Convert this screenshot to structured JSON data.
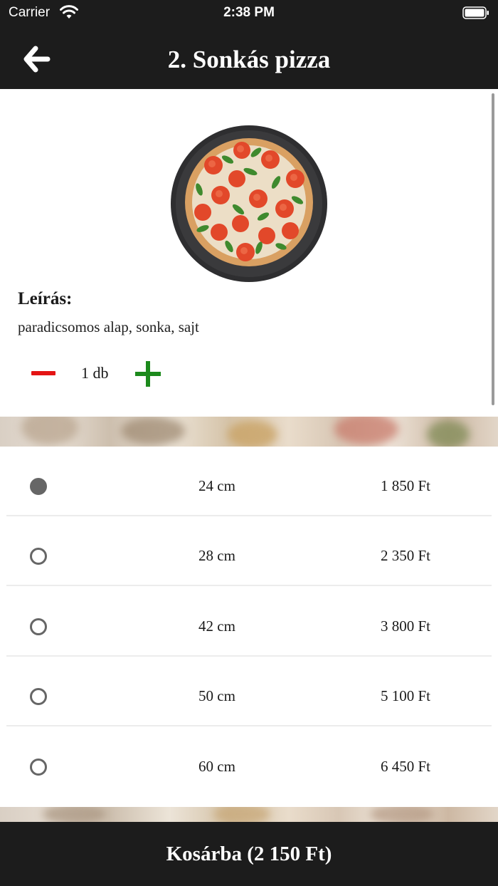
{
  "status_bar": {
    "carrier": "Carrier",
    "time": "2:38 PM",
    "wifi_icon": "wifi-icon",
    "battery_icon": "battery-icon"
  },
  "header": {
    "title": "2. Sonkás pizza",
    "back_icon": "arrow-left-icon"
  },
  "product": {
    "image_icon": "pizza-image",
    "description_heading": "Leírás:",
    "description": "paradicsomos alap, sonka, sajt",
    "quantity": "1 db",
    "minus_icon": "minus-icon",
    "plus_icon": "plus-icon"
  },
  "sizes": [
    {
      "size": "24 cm",
      "price": "1 850 Ft",
      "selected": true
    },
    {
      "size": "28 cm",
      "price": "2 350 Ft",
      "selected": false
    },
    {
      "size": "42 cm",
      "price": "3 800 Ft",
      "selected": false
    },
    {
      "size": "50 cm",
      "price": "5 100 Ft",
      "selected": false
    },
    {
      "size": "60 cm",
      "price": "6 450 Ft",
      "selected": false
    }
  ],
  "cart_button": {
    "label": "Kosárba (2 150 Ft)"
  },
  "colors": {
    "bar_background": "#1c1c1c",
    "minus": "#e41414",
    "plus": "#1c8a1c",
    "radio": "#666666"
  }
}
